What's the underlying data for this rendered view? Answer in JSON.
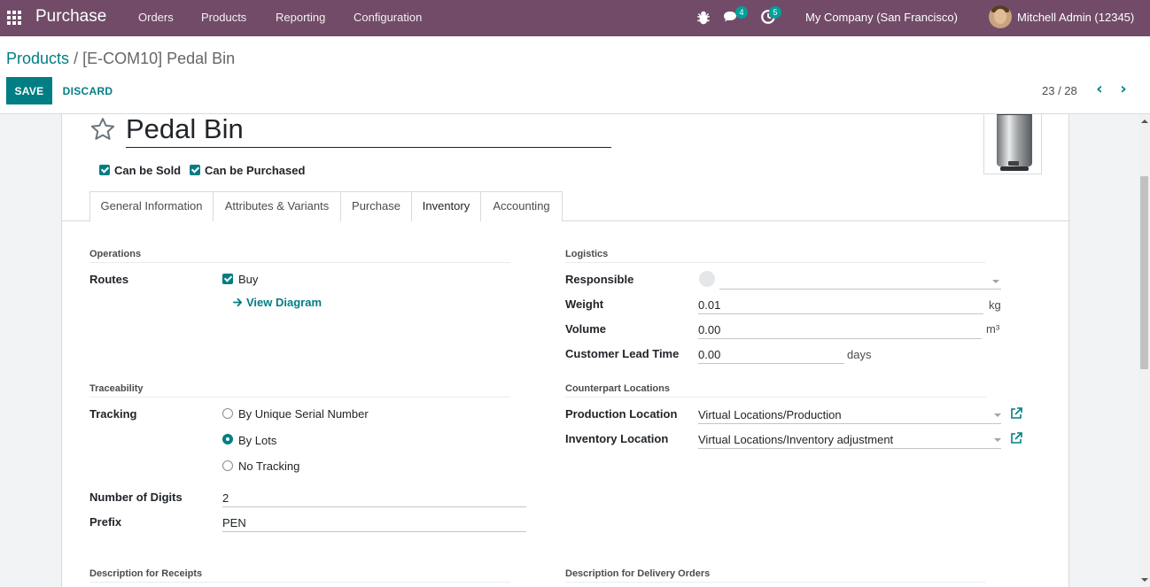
{
  "navbar": {
    "app_name": "Purchase",
    "menu": [
      "Orders",
      "Products",
      "Reporting",
      "Configuration"
    ],
    "chat_count": "4",
    "activity_count": "5",
    "company": "My Company (San Francisco)",
    "user": "Mitchell Admin (12345)"
  },
  "breadcrumb": {
    "parent": "Products",
    "separator": "/",
    "current": "[E-COM10] Pedal Bin"
  },
  "actions": {
    "save": "SAVE",
    "discard": "DISCARD"
  },
  "pager": {
    "value": "23 / 28"
  },
  "product": {
    "name": "Pedal Bin",
    "can_be_sold": "Can be Sold",
    "can_be_purchased": "Can be Purchased"
  },
  "tabs": [
    "General Information",
    "Attributes & Variants",
    "Purchase",
    "Inventory",
    "Accounting"
  ],
  "active_tab": "Inventory",
  "operations": {
    "title": "Operations",
    "routes_label": "Routes",
    "route_buy": "Buy",
    "view_diagram": "View Diagram"
  },
  "logistics": {
    "title": "Logistics",
    "responsible_label": "Responsible",
    "responsible_value": "",
    "weight_label": "Weight",
    "weight_value": "0.01",
    "weight_unit": "kg",
    "volume_label": "Volume",
    "volume_value": "0.00",
    "volume_unit": "m³",
    "lead_time_label": "Customer Lead Time",
    "lead_time_value": "0.00",
    "lead_time_unit": "days"
  },
  "traceability": {
    "title": "Traceability",
    "tracking_label": "Tracking",
    "options": [
      "By Unique Serial Number",
      "By Lots",
      "No Tracking"
    ],
    "selected": "By Lots",
    "digits_label": "Number of Digits",
    "digits_value": "2",
    "prefix_label": "Prefix",
    "prefix_value": "PEN"
  },
  "counterpart": {
    "title": "Counterpart Locations",
    "production_label": "Production Location",
    "production_value": "Virtual Locations/Production",
    "inventory_label": "Inventory Location",
    "inventory_value": "Virtual Locations/Inventory adjustment"
  },
  "descriptions": {
    "receipts": "Description for Receipts",
    "delivery": "Description for Delivery Orders"
  },
  "colors": {
    "navbar": "#714B67",
    "accent": "#017e84",
    "badge": "#01A09B"
  }
}
